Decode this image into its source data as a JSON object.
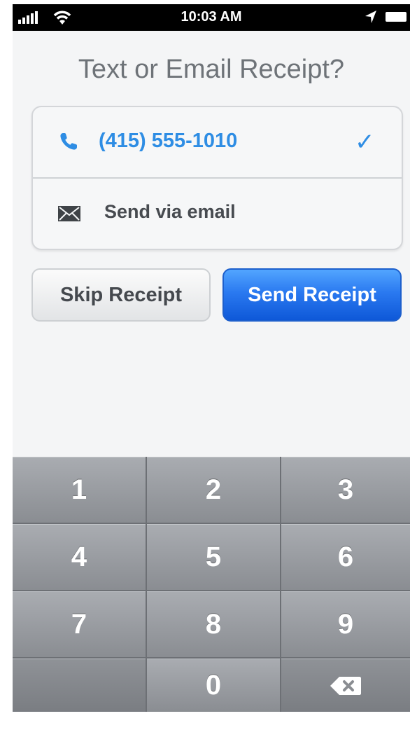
{
  "status_bar": {
    "time": "10:03 AM"
  },
  "title": "Text or Email Receipt?",
  "options": {
    "phone_label": "(415) 555-1010",
    "phone_checkmark": "✓",
    "email_label": "Send via email"
  },
  "buttons": {
    "skip_label": "Skip Receipt",
    "send_label": "Send Receipt"
  },
  "keypad": {
    "keys": [
      "1",
      "2",
      "3",
      "4",
      "5",
      "6",
      "7",
      "8",
      "9",
      "",
      "0",
      "delete"
    ]
  },
  "colors": {
    "accent_blue": "#2e8de4",
    "send_button_blue": "#1d6ae8",
    "keypad_gray": "#9b9ea3"
  },
  "icons": {
    "phone": "phone-icon",
    "mail": "envelope-icon",
    "check": "checkmark-icon",
    "delete": "backspace-icon"
  }
}
